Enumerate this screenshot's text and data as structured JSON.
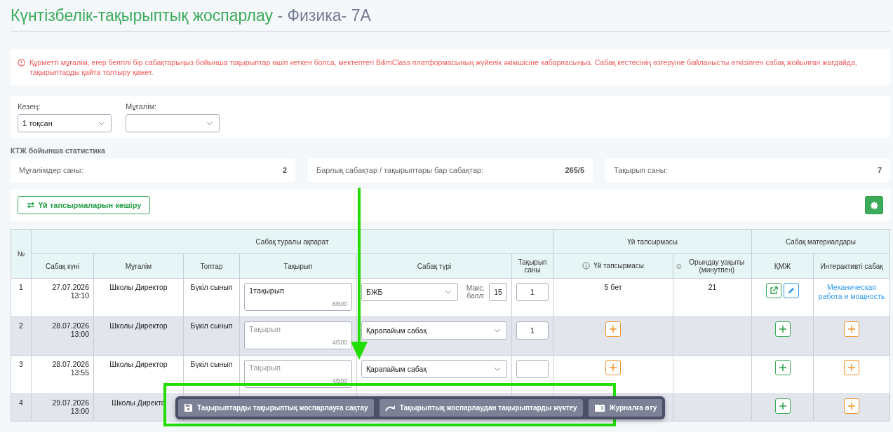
{
  "title": {
    "main": "Күнтізбелік-тақырыптық жоспарлау",
    "subject": "- Физика- 7А"
  },
  "alert": "Құрметті мұғалім, егер белгілі бір сабақтарыңыз бойынша тақырыптар өшіп кеткен болса, мектептегі BilimClass платформасының жүйелік әкімшісіне хабарласыңыз. Сабақ кестесінің өзгеруіне байланысты өткізілген сабақ жойылған жағдайда, тақырыптарды қайта толтыру қажет.",
  "filters": [
    {
      "label": "Кезең:",
      "value": "1 тоқсан"
    },
    {
      "label": "Мұғалім:"
    }
  ],
  "stats_title": "КТЖ бойынша статистика",
  "stats": [
    {
      "label": "Мұғалімдер саны:",
      "value": "2"
    },
    {
      "label": "Барлық сабақтар / тақырыптары бар сабақтар:",
      "value": "265/5"
    },
    {
      "label": "Тақырып саны:",
      "value": "7"
    }
  ],
  "copy_button": "Үй тапсырмаларын көшіру",
  "table": {
    "number_header": "№",
    "groups": [
      {
        "label": "Сабақ туралы ақпарат"
      },
      {
        "label": "Үй тапсырмасы"
      },
      {
        "label": "Сабақ материалдары"
      }
    ],
    "columns": [
      {
        "label": "Сабақ күні"
      },
      {
        "label": "Мұғалім"
      },
      {
        "label": "Топтар"
      },
      {
        "label": "Тақырып"
      },
      {
        "label": "Сабақ түрі"
      },
      {
        "label": "Тақырып саны"
      },
      {
        "label": "Үй тапсырмасы",
        "info": true
      },
      {
        "label": "Орындау уақыты (минутпен)",
        "info": true
      },
      {
        "label": "ҚМЖ"
      },
      {
        "label": "Интерактивті сабақ"
      }
    ],
    "rows": [
      {
        "number": "1",
        "date": "27.07.2026",
        "time": "13:10",
        "teacher": "Школы Директор",
        "groups": "Бүкіл сынып",
        "topic": {
          "value": "1тақырып",
          "counter": "8/500"
        },
        "lesson_type": "БЖБ",
        "max_score": {
          "label": "Макс. балл:",
          "value": "15"
        },
        "topic_count": "1",
        "homework": {
          "kind": "text",
          "text": "5 бет"
        },
        "duration": "21",
        "kmzh": {
          "kind": "actions"
        },
        "interactive": {
          "kind": "link",
          "text": "Механическая работа и мощность"
        }
      },
      {
        "number": "2",
        "date": "28.07.2026",
        "time": "13:00",
        "teacher": "Школы Директор",
        "groups": "Бүкіл сынып",
        "topic": {
          "placeholder": "Тақырып",
          "counter": "4/500"
        },
        "lesson_type": "Қарапайым сабақ",
        "topic_count": "1",
        "homework": {
          "kind": "add"
        },
        "kmzh": {
          "kind": "add"
        },
        "interactive": {
          "kind": "add"
        }
      },
      {
        "number": "3",
        "date": "28.07.2026",
        "time": "13:55",
        "teacher": "Школы Директор",
        "groups": "Бүкіл сынып",
        "topic": {
          "placeholder": "Тақырып",
          "counter": "4/500"
        },
        "lesson_type": "Қарапайым сабақ",
        "topic_count": "",
        "homework": {
          "kind": "add"
        },
        "kmzh": {
          "kind": "add"
        },
        "interactive": {
          "kind": "add"
        }
      },
      {
        "number": "4",
        "date": "29.07.2026",
        "time": "13:00",
        "teacher": "Школы Директо",
        "kmzh": {
          "kind": "add"
        },
        "interactive": {
          "kind": "add"
        }
      }
    ]
  },
  "action_bar": [
    {
      "kind": "save",
      "label": "Тақырыптарды тақырыптық жоспарлауға сақтау"
    },
    {
      "kind": "load",
      "label": "Тақырыптық жоспарлаудан тақырыптарды жүктеу"
    },
    {
      "kind": "journal",
      "label": "Журналға өту"
    }
  ]
}
